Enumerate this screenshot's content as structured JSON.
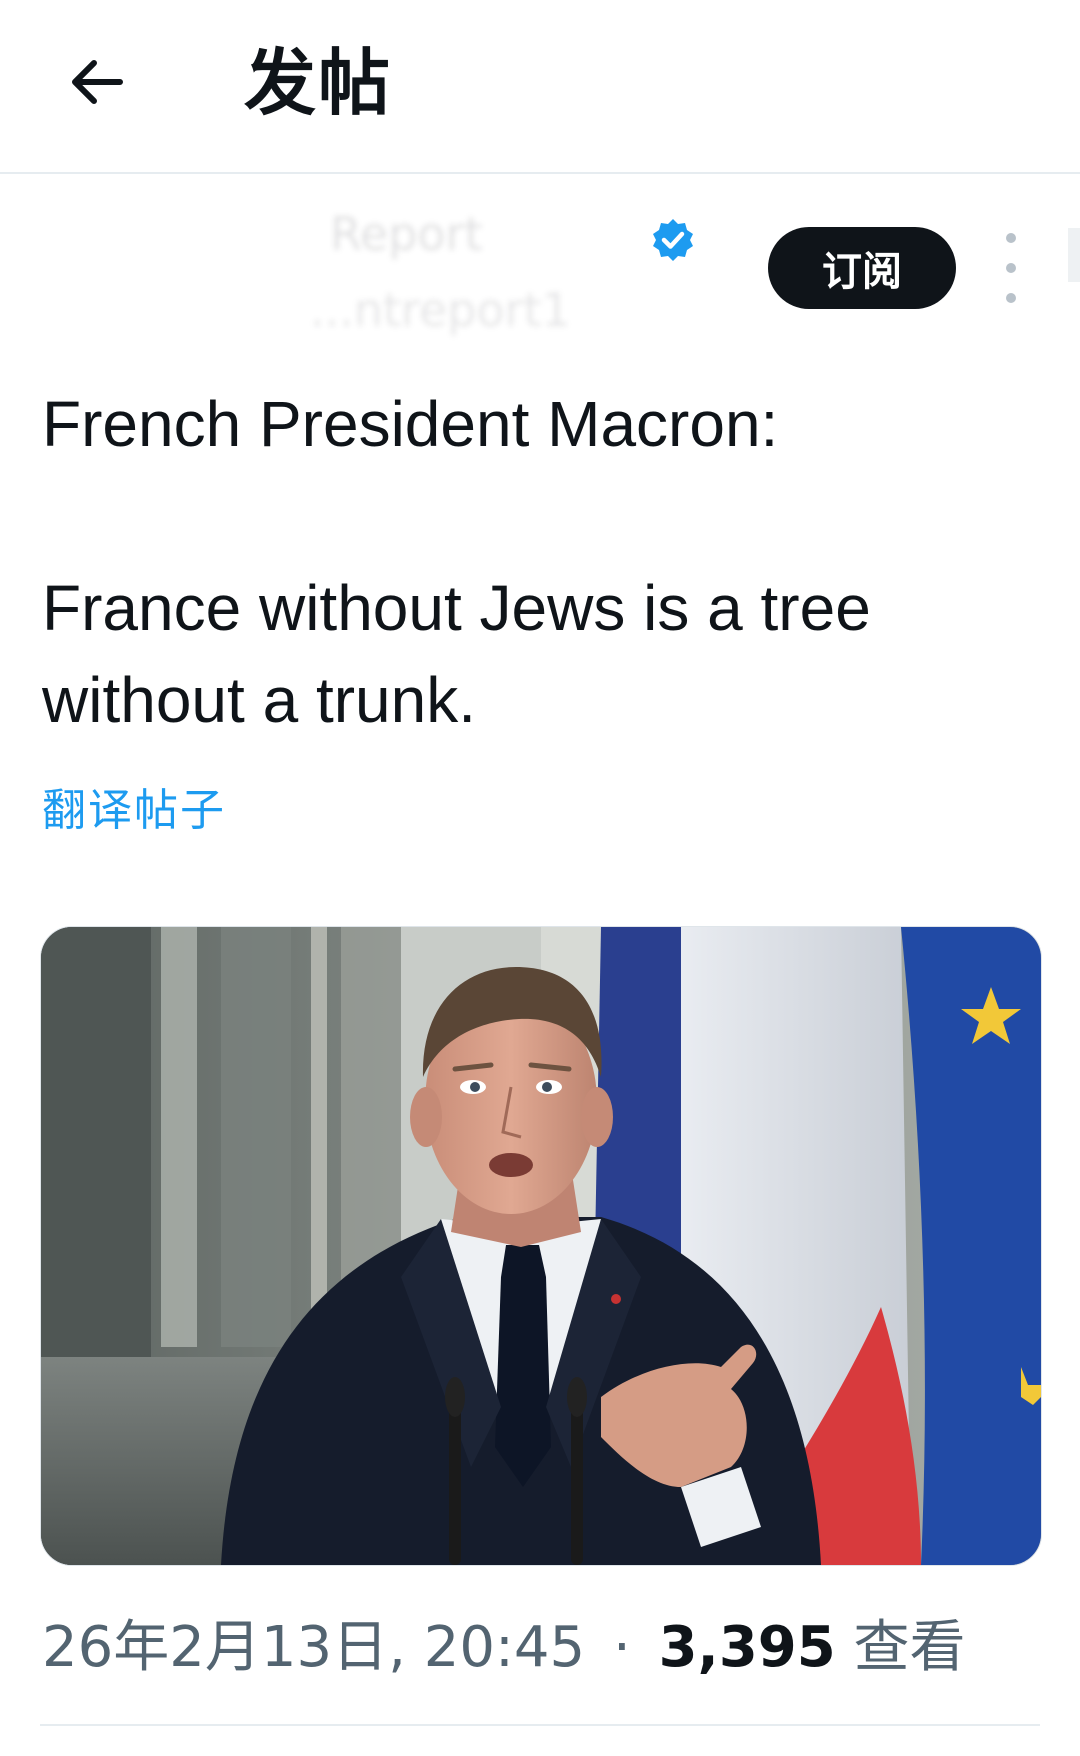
{
  "header": {
    "back_icon": "arrow-left-icon",
    "title": "发帖"
  },
  "author": {
    "name": "Report",
    "handle": "...ntreport1",
    "verified_icon": "verified-badge-icon",
    "badge_color": "#1d9bf0",
    "subscribe_label": "订阅",
    "more_icon": "more-vertical-icon"
  },
  "tweet": {
    "line1": "French President Macron:",
    "line2": "France without Jews is a tree",
    "line3": "without a trunk.",
    "translate_label": "翻译帖子",
    "link_color": "#1d9bf0"
  },
  "photo": {
    "subject": "press-photo"
  },
  "meta": {
    "datetime": "26年2月13日, 20:45",
    "separator": "·",
    "view_count": "3,395",
    "view_label": "查看"
  }
}
